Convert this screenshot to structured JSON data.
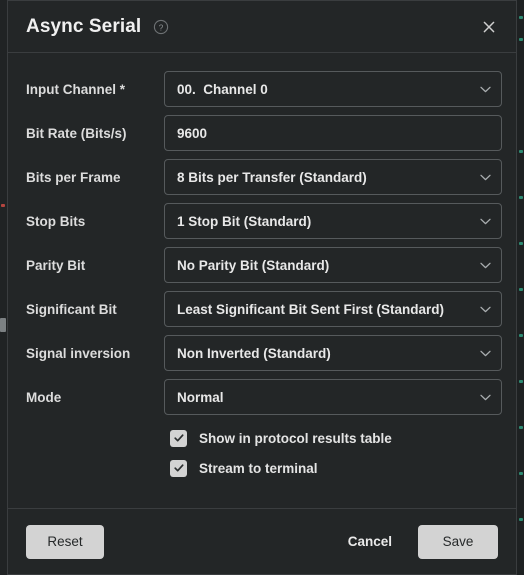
{
  "window": {
    "title": "Async Serial",
    "help_icon": "help-circle-icon",
    "close_icon": "close-icon"
  },
  "form": {
    "fields": [
      {
        "label": "Input Channel *",
        "value": "00.  Channel 0",
        "type": "select",
        "icon": "chevron-down-icon"
      },
      {
        "label": "Bit Rate (Bits/s)",
        "value": "9600",
        "type": "text",
        "icon": ""
      },
      {
        "label": "Bits per Frame",
        "value": "8 Bits per Transfer (Standard)",
        "type": "select",
        "icon": "chevron-down-icon"
      },
      {
        "label": "Stop Bits",
        "value": "1 Stop Bit (Standard)",
        "type": "select",
        "icon": "chevron-down-icon"
      },
      {
        "label": "Parity Bit",
        "value": "No Parity Bit (Standard)",
        "type": "select",
        "icon": "chevron-down-icon"
      },
      {
        "label": "Significant Bit",
        "value": "Least Significant Bit Sent First (Standard)",
        "type": "select",
        "icon": "chevron-down-icon"
      },
      {
        "label": "Signal inversion",
        "value": "Non Inverted (Standard)",
        "type": "select",
        "icon": "chevron-down-icon"
      },
      {
        "label": "Mode",
        "value": "Normal",
        "type": "select",
        "icon": "chevron-down-icon"
      }
    ],
    "checkboxes": [
      {
        "label": "Show in protocol results table",
        "checked": true
      },
      {
        "label": "Stream to terminal",
        "checked": true
      }
    ]
  },
  "footer": {
    "reset_label": "Reset",
    "cancel_label": "Cancel",
    "save_label": "Save"
  },
  "colors": {
    "dialog_background": "#232627",
    "app_background": "#1b1d1e",
    "border": "#3a3d3f",
    "field_border": "#565a5c",
    "text_primary": "#f0f0f0",
    "text_secondary": "#dcdcdc",
    "button_light": "#d3d3d3",
    "button_light_text": "#26292a"
  }
}
